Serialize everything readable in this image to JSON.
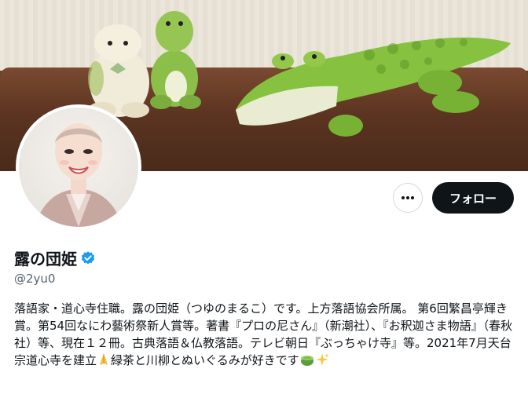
{
  "profile": {
    "display_name": "露の団姫",
    "handle": "@2yu0",
    "verified": true,
    "bio": "落語家・道心寺住職。露の団姫（つゆのまるこ）です。上方落語協会所属。 第6回繁昌亭輝き賞。第54回なにわ藝術祭新人賞等。著書『プロの尼さん』（新潮社）、『お釈迦さま物語』（春秋社）等、現在１２冊。古典落語＆仏教落語。テレビ朝日『ぶっちゃけ寺』等。2021年7月天台宗道心寺を建立",
    "bio_tail": "緑茶と川柳とぬいぐるみが好きです"
  },
  "actions": {
    "more_icon": "more-horizontal-icon",
    "follow_label": "フォロー"
  },
  "icons": {
    "verified": "verified-badge-icon",
    "emoji_1": "folded-hands-emoji",
    "emoji_2": "green-tea-emoji",
    "emoji_3": "sparkles-emoji"
  },
  "colors": {
    "text": "#0f1419",
    "secondary": "#536471",
    "verified_blue": "#1d9bf0",
    "follow_bg": "#0f1419"
  }
}
